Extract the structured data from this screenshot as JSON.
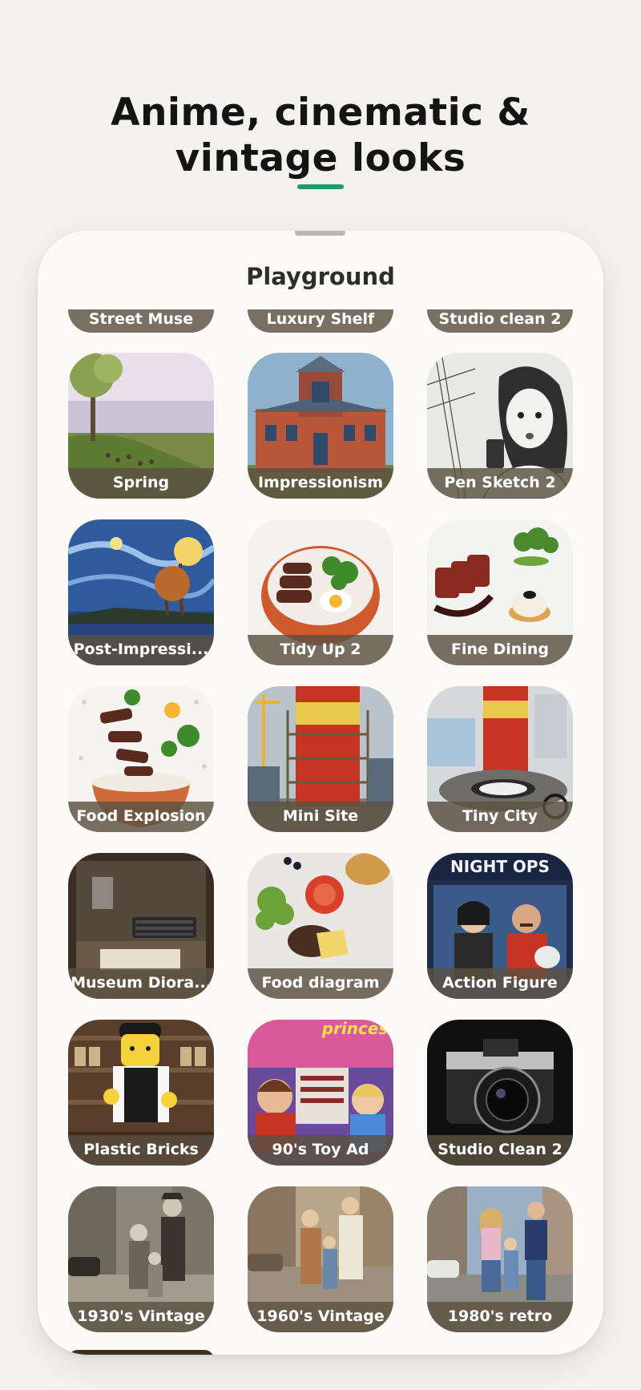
{
  "headline": {
    "line1": "Anime, cinematic &",
    "line2": "vintage looks"
  },
  "accent_color": "#1f9a6f",
  "sheet": {
    "title": "Playground",
    "partial_row": [
      "Street Muse",
      "Luxury Shelf",
      "Studio clean 2"
    ],
    "styles": [
      {
        "label": "Spring",
        "image": "lakeside-geese-painting"
      },
      {
        "label": "Impressionism",
        "image": "victorian-house-painting"
      },
      {
        "label": "Pen Sketch 2",
        "image": "woman-phone-sketch"
      },
      {
        "label": "Post-Impressi...",
        "image": "starry-night-lake"
      },
      {
        "label": "Tidy Up 2",
        "image": "steak-rice-bowl"
      },
      {
        "label": "Fine Dining",
        "image": "plated-steak-dish"
      },
      {
        "label": "Food Explosion",
        "image": "exploding-food-bowl"
      },
      {
        "label": "Mini Site",
        "image": "can-construction-site"
      },
      {
        "label": "Tiny City",
        "image": "can-miniature-city"
      },
      {
        "label": "Museum Diora...",
        "image": "workstation-diorama"
      },
      {
        "label": "Food diagram",
        "image": "burger-ingredients"
      },
      {
        "label": "Action Figure",
        "image": "night-ops-figure-box"
      },
      {
        "label": "Plastic Bricks",
        "image": "brick-figure-bartender"
      },
      {
        "label": "90's Toy Ad",
        "image": "kids-toy-boat-ad"
      },
      {
        "label": "Studio Clean 2",
        "image": "film-camera"
      },
      {
        "label": "1930's Vintage",
        "image": "family-street-1930s"
      },
      {
        "label": "1960's Vintage",
        "image": "family-street-1960s"
      },
      {
        "label": "1980's retro",
        "image": "family-street-1980s"
      }
    ]
  }
}
